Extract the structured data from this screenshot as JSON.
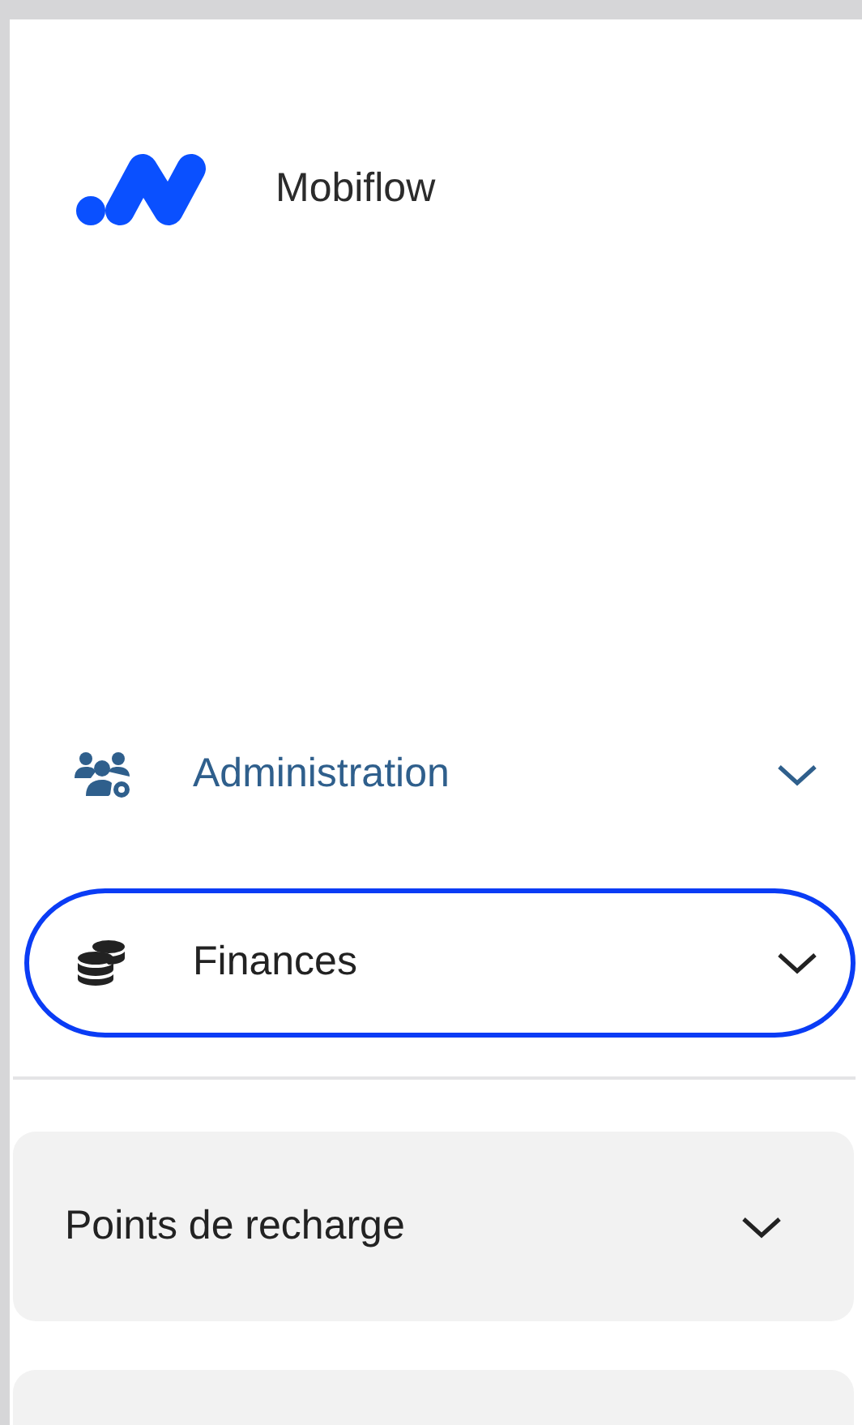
{
  "brand": {
    "name": "Mobiflow"
  },
  "menu": [
    {
      "kind": "row",
      "label": "Administration",
      "active": true,
      "expanded": false,
      "circled": false
    },
    {
      "kind": "row",
      "label": "Finances",
      "active": false,
      "expanded": false,
      "circled": true
    }
  ],
  "sections": [
    {
      "kind": "labeled",
      "label": "Points de recharge",
      "expanded": false
    },
    {
      "kind": "blank"
    }
  ]
}
